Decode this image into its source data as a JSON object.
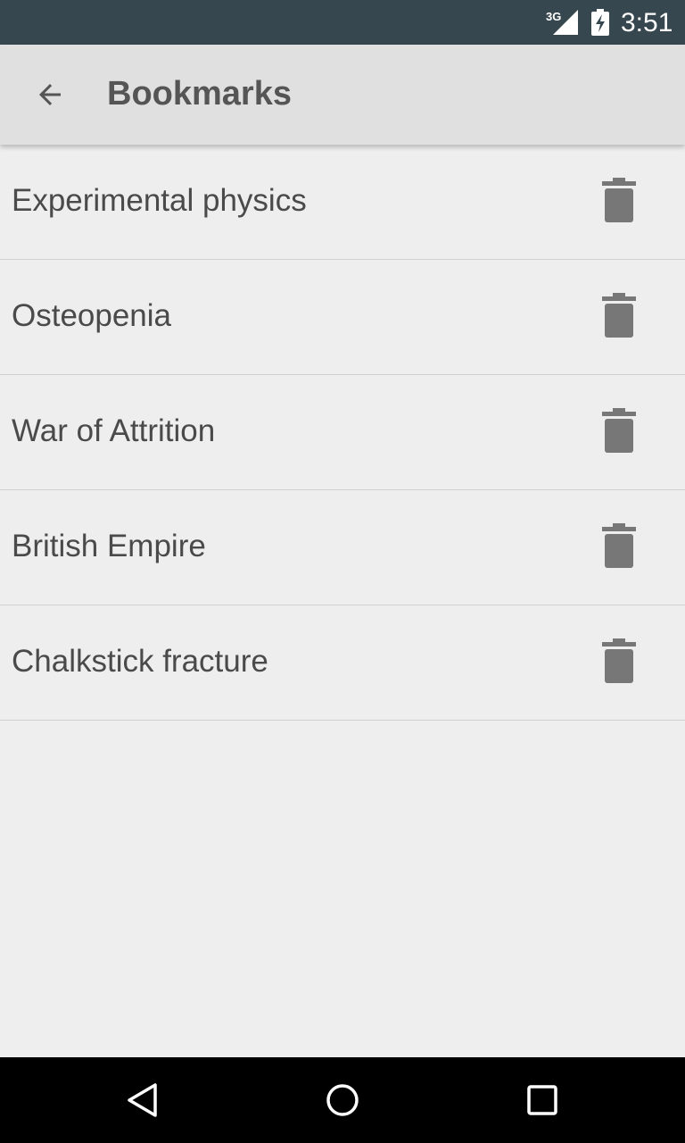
{
  "status_bar": {
    "network_label": "3G",
    "time": "3:51",
    "background_color": "#37474f",
    "icons": [
      "signal-icon",
      "battery-charging-icon"
    ]
  },
  "app_bar": {
    "title": "Bookmarks",
    "back_icon": "arrow-back-icon",
    "background_color": "#e0e0e0"
  },
  "bookmarks": [
    {
      "title": "Experimental physics",
      "action_icon": "trash-icon"
    },
    {
      "title": "Osteopenia",
      "action_icon": "trash-icon"
    },
    {
      "title": "War of Attrition",
      "action_icon": "trash-icon"
    },
    {
      "title": "British Empire",
      "action_icon": "trash-icon"
    },
    {
      "title": "Chalkstick fracture",
      "action_icon": "trash-icon"
    }
  ],
  "nav_bar": {
    "buttons": [
      "back-triangle-icon",
      "home-circle-icon",
      "recents-square-icon"
    ],
    "background_color": "#000000"
  }
}
